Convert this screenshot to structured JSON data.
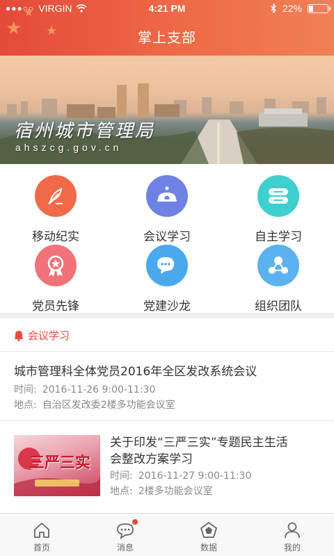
{
  "status_bar": {
    "carrier": "VIRGIN",
    "time": "4:21 PM",
    "battery_text": "22%",
    "battery_level": 0.22,
    "signal_icon": "signal-dots-icon",
    "wifi_icon": "wifi-icon",
    "bluetooth_icon": "bluetooth-icon"
  },
  "header": {
    "title": "掌上支部"
  },
  "banner": {
    "calligraphy": "宿州城市管理局",
    "url": "ahszcg.gov.cn"
  },
  "grid": [
    {
      "label": "移动纪实",
      "icon": "feather-icon",
      "color": "#f06a4a"
    },
    {
      "label": "会议学习",
      "icon": "meeting-icon",
      "color": "#6e82e6"
    },
    {
      "label": "自主学习",
      "icon": "book-icon",
      "color": "#3fcfcf"
    },
    {
      "label": "党员先锋",
      "icon": "medal-icon",
      "color": "#f0737a"
    },
    {
      "label": "党建沙龙",
      "icon": "chat-icon",
      "color": "#4aa9ec"
    },
    {
      "label": "组织团队",
      "icon": "team-icon",
      "color": "#5bb2ee"
    }
  ],
  "section": {
    "title": "会议学习",
    "accent": "#e74b3b",
    "icon": "bell-icon"
  },
  "items": [
    {
      "title": "城市管理科全体党员2016年全区发改系统会议",
      "time_label": "时间:",
      "time_value": "2016-11-26  9:00-11:30",
      "place_label": "地点:",
      "place_value": "自治区发改委2楼多功能会议室"
    },
    {
      "title_line1": "关于印发“三严三实”专题民主生活",
      "title_line2": "会整改方案学习",
      "time_label": "时间:",
      "time_value": "2016-11-27  9:00-11:30",
      "place_label": "地点:",
      "place_value": "2楼多功能会议室",
      "thumb_text": "三严三实"
    }
  ],
  "tabbar": [
    {
      "label": "首页",
      "icon": "home-icon"
    },
    {
      "label": "消息",
      "icon": "message-icon",
      "badge": true
    },
    {
      "label": "数据",
      "icon": "data-icon"
    },
    {
      "label": "我的",
      "icon": "user-icon"
    }
  ]
}
